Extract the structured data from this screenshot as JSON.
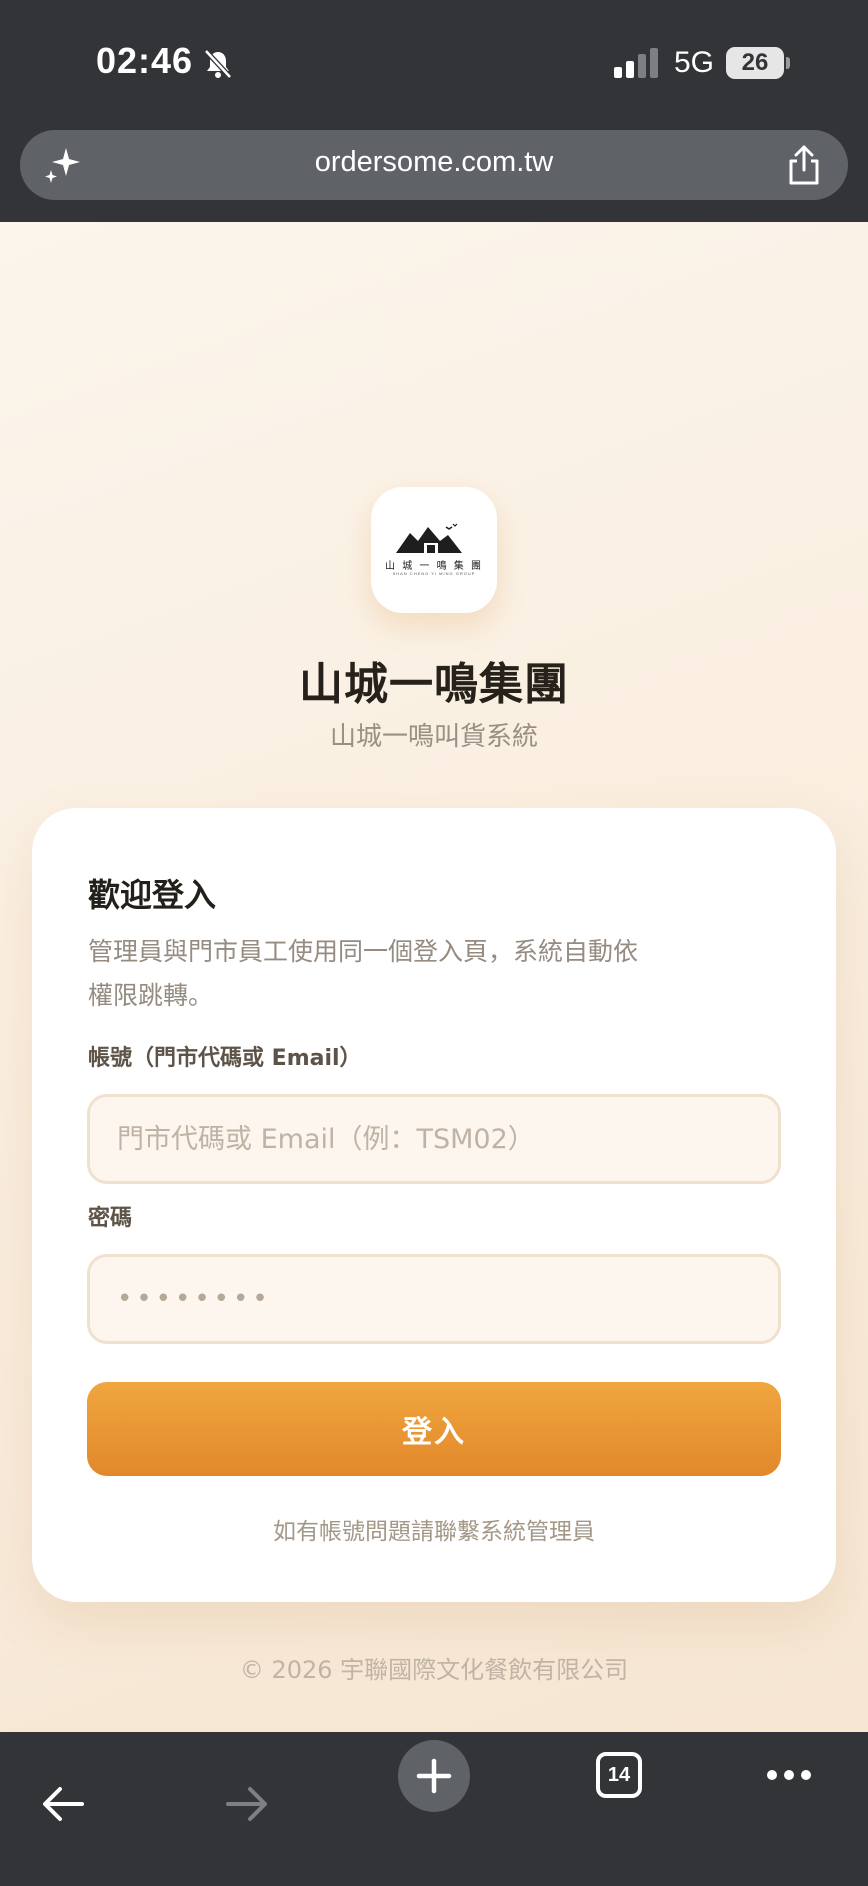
{
  "status_bar": {
    "time": "02:46",
    "network": "5G",
    "battery": "26"
  },
  "browser": {
    "url": "ordersome.com.tw"
  },
  "brand": {
    "logo_text": "山 城 一 鳴 集 團",
    "logo_subtext": "SHAN CHENG YI MING GROUP",
    "title": "山城一鳴集團",
    "subtitle": "山城一鳴叫貨系統"
  },
  "login_card": {
    "title": "歡迎登入",
    "description": "管理員與門市員工使用同一個登入頁，系統自動依權限跳轉。",
    "account_label": "帳號（門市代碼或 Email）",
    "account_placeholder": "門市代碼或 Email（例：TSM02）",
    "password_label": "密碼",
    "password_value": "••••••••",
    "login_button": "登入",
    "help_text": "如有帳號問題請聯繫系統管理員"
  },
  "footer": {
    "copyright": "© 2026 宇聯國際文化餐飲有限公司"
  },
  "toolbar": {
    "tab_count": "14"
  },
  "colors": {
    "accent": "#e89434",
    "card_background": "#ffffff",
    "page_background": "#faefe1",
    "browser_chrome": "#323438"
  },
  "icons": [
    "bell-slash-icon",
    "signal-icon",
    "sparkle-icon",
    "share-icon",
    "back-arrow-icon",
    "forward-arrow-icon",
    "plus-icon",
    "tabs-icon",
    "more-icon"
  ]
}
